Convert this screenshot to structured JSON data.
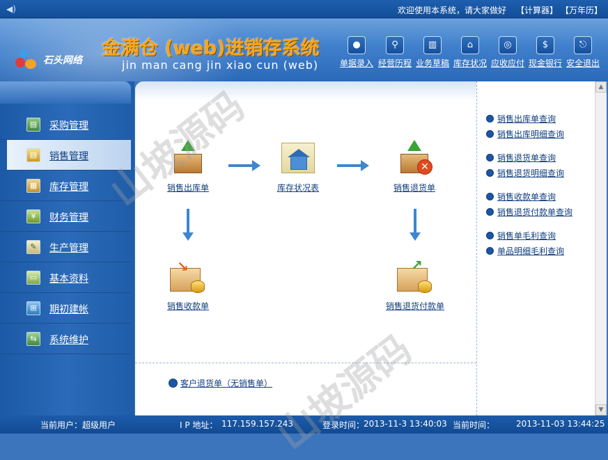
{
  "topbar": {
    "welcome": "欢迎使用本系统，请大家做好",
    "calculator": "【计算器】",
    "calendar": "【万年历】"
  },
  "header": {
    "logo_text": "石头网络",
    "title": "金满仓 (web)进销存系统",
    "subtitle": "jin man cang jin xiao cun (web)"
  },
  "toolbar": [
    {
      "label": "单据录入",
      "icon": "person-icon"
    },
    {
      "label": "经营历程",
      "icon": "search-icon"
    },
    {
      "label": "业务草稿",
      "icon": "trash-icon"
    },
    {
      "label": "库存状况",
      "icon": "home-icon"
    },
    {
      "label": "应收应付",
      "icon": "money-bag-icon"
    },
    {
      "label": "现金银行",
      "icon": "dollar-icon"
    },
    {
      "label": "安全退出",
      "icon": "exit-icon"
    }
  ],
  "sidebar": {
    "items": [
      {
        "label": "采购管理"
      },
      {
        "label": "销售管理"
      },
      {
        "label": "库存管理"
      },
      {
        "label": "财务管理"
      },
      {
        "label": "生产管理"
      },
      {
        "label": "基本资料"
      },
      {
        "label": "期初建帐"
      },
      {
        "label": "系统维护"
      }
    ],
    "active_index": 1
  },
  "flow": {
    "sales_outbound": "销售出库单",
    "stock_status": "库存状况表",
    "sales_return": "销售退货单",
    "sales_receipt": "销售收款单",
    "return_payment": "销售退货付款单"
  },
  "queries": {
    "items": [
      "销售出库单查询",
      "销售出库明细查询",
      "销售退货单查询",
      "销售退货明细查询",
      "销售收款单查询",
      "销售退货付款单查询",
      "销售单毛利查询",
      "单品明细毛利查询"
    ]
  },
  "customer_return": "客户退货单（无销售单）",
  "status": {
    "user_label": "当前用户：",
    "user_value": "超级用户",
    "ip_label": "I P 地址：",
    "ip_value": "117.159.157.243",
    "login_label": "登录时间：",
    "login_value": "2013-11-3 13:40:03",
    "now_label": "当前时间：",
    "now_value": "2013-11-03 13:44:25"
  },
  "watermark": "山坡源码"
}
